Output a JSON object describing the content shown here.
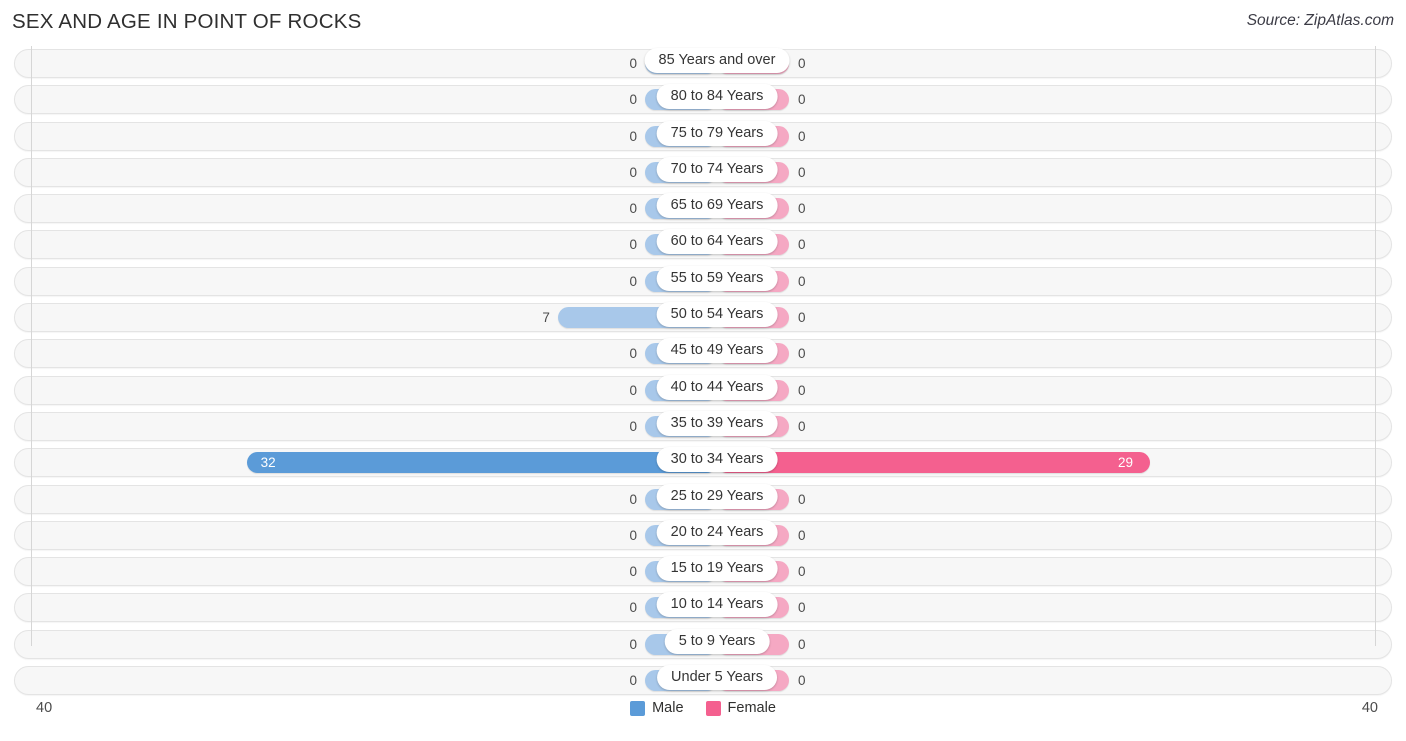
{
  "header": {
    "title": "SEX AND AGE IN POINT OF ROCKS",
    "source": "Source: ZipAtlas.com"
  },
  "axis": {
    "left_label": "40",
    "right_label": "40",
    "max": 40
  },
  "legend": {
    "items": [
      {
        "label": "Male",
        "color": "#5b9bd8"
      },
      {
        "label": "Female",
        "color": "#f4608f"
      }
    ]
  },
  "colors": {
    "male_light": "#a8c8ea",
    "male_strong": "#5b9bd8",
    "female_light": "#f5a8c3",
    "female_strong": "#f4608f",
    "track": "#f7f7f7",
    "track_border": "#e4e4e4"
  },
  "chart_data": {
    "type": "bar",
    "subtype": "population-pyramid",
    "title": "SEX AND AGE IN POINT OF ROCKS",
    "xlabel": "",
    "ylabel": "",
    "xlim": [
      40,
      40
    ],
    "grid": false,
    "legend_position": "bottom-center",
    "categories": [
      "85 Years and over",
      "80 to 84 Years",
      "75 to 79 Years",
      "70 to 74 Years",
      "65 to 69 Years",
      "60 to 64 Years",
      "55 to 59 Years",
      "50 to 54 Years",
      "45 to 49 Years",
      "40 to 44 Years",
      "35 to 39 Years",
      "30 to 34 Years",
      "25 to 29 Years",
      "20 to 24 Years",
      "15 to 19 Years",
      "10 to 14 Years",
      "5 to 9 Years",
      "Under 5 Years"
    ],
    "series": [
      {
        "name": "Male",
        "color": "#5b9bd8",
        "values": [
          0,
          0,
          0,
          0,
          0,
          0,
          0,
          7,
          0,
          0,
          0,
          32,
          0,
          0,
          0,
          0,
          0,
          0
        ]
      },
      {
        "name": "Female",
        "color": "#f4608f",
        "values": [
          0,
          0,
          0,
          0,
          0,
          0,
          0,
          0,
          0,
          0,
          0,
          29,
          0,
          0,
          0,
          0,
          0,
          0
        ]
      }
    ]
  },
  "rows": [
    {
      "label": "85 Years and over",
      "male": 0,
      "male_text": "0",
      "female": 0,
      "female_text": "0",
      "highlight": false
    },
    {
      "label": "80 to 84 Years",
      "male": 0,
      "male_text": "0",
      "female": 0,
      "female_text": "0",
      "highlight": false
    },
    {
      "label": "75 to 79 Years",
      "male": 0,
      "male_text": "0",
      "female": 0,
      "female_text": "0",
      "highlight": false
    },
    {
      "label": "70 to 74 Years",
      "male": 0,
      "male_text": "0",
      "female": 0,
      "female_text": "0",
      "highlight": false
    },
    {
      "label": "65 to 69 Years",
      "male": 0,
      "male_text": "0",
      "female": 0,
      "female_text": "0",
      "highlight": false
    },
    {
      "label": "60 to 64 Years",
      "male": 0,
      "male_text": "0",
      "female": 0,
      "female_text": "0",
      "highlight": false
    },
    {
      "label": "55 to 59 Years",
      "male": 0,
      "male_text": "0",
      "female": 0,
      "female_text": "0",
      "highlight": false
    },
    {
      "label": "50 to 54 Years",
      "male": 7,
      "male_text": "7",
      "female": 0,
      "female_text": "0",
      "highlight": false
    },
    {
      "label": "45 to 49 Years",
      "male": 0,
      "male_text": "0",
      "female": 0,
      "female_text": "0",
      "highlight": false
    },
    {
      "label": "40 to 44 Years",
      "male": 0,
      "male_text": "0",
      "female": 0,
      "female_text": "0",
      "highlight": false
    },
    {
      "label": "35 to 39 Years",
      "male": 0,
      "male_text": "0",
      "female": 0,
      "female_text": "0",
      "highlight": false
    },
    {
      "label": "30 to 34 Years",
      "male": 32,
      "male_text": "32",
      "female": 29,
      "female_text": "29",
      "highlight": true
    },
    {
      "label": "25 to 29 Years",
      "male": 0,
      "male_text": "0",
      "female": 0,
      "female_text": "0",
      "highlight": false
    },
    {
      "label": "20 to 24 Years",
      "male": 0,
      "male_text": "0",
      "female": 0,
      "female_text": "0",
      "highlight": false
    },
    {
      "label": "15 to 19 Years",
      "male": 0,
      "male_text": "0",
      "female": 0,
      "female_text": "0",
      "highlight": false
    },
    {
      "label": "10 to 14 Years",
      "male": 0,
      "male_text": "0",
      "female": 0,
      "female_text": "0",
      "highlight": false
    },
    {
      "label": "5 to 9 Years",
      "male": 0,
      "male_text": "0",
      "female": 0,
      "female_text": "0",
      "highlight": false
    },
    {
      "label": "Under 5 Years",
      "male": 0,
      "male_text": "0",
      "female": 0,
      "female_text": "0",
      "highlight": false
    }
  ]
}
